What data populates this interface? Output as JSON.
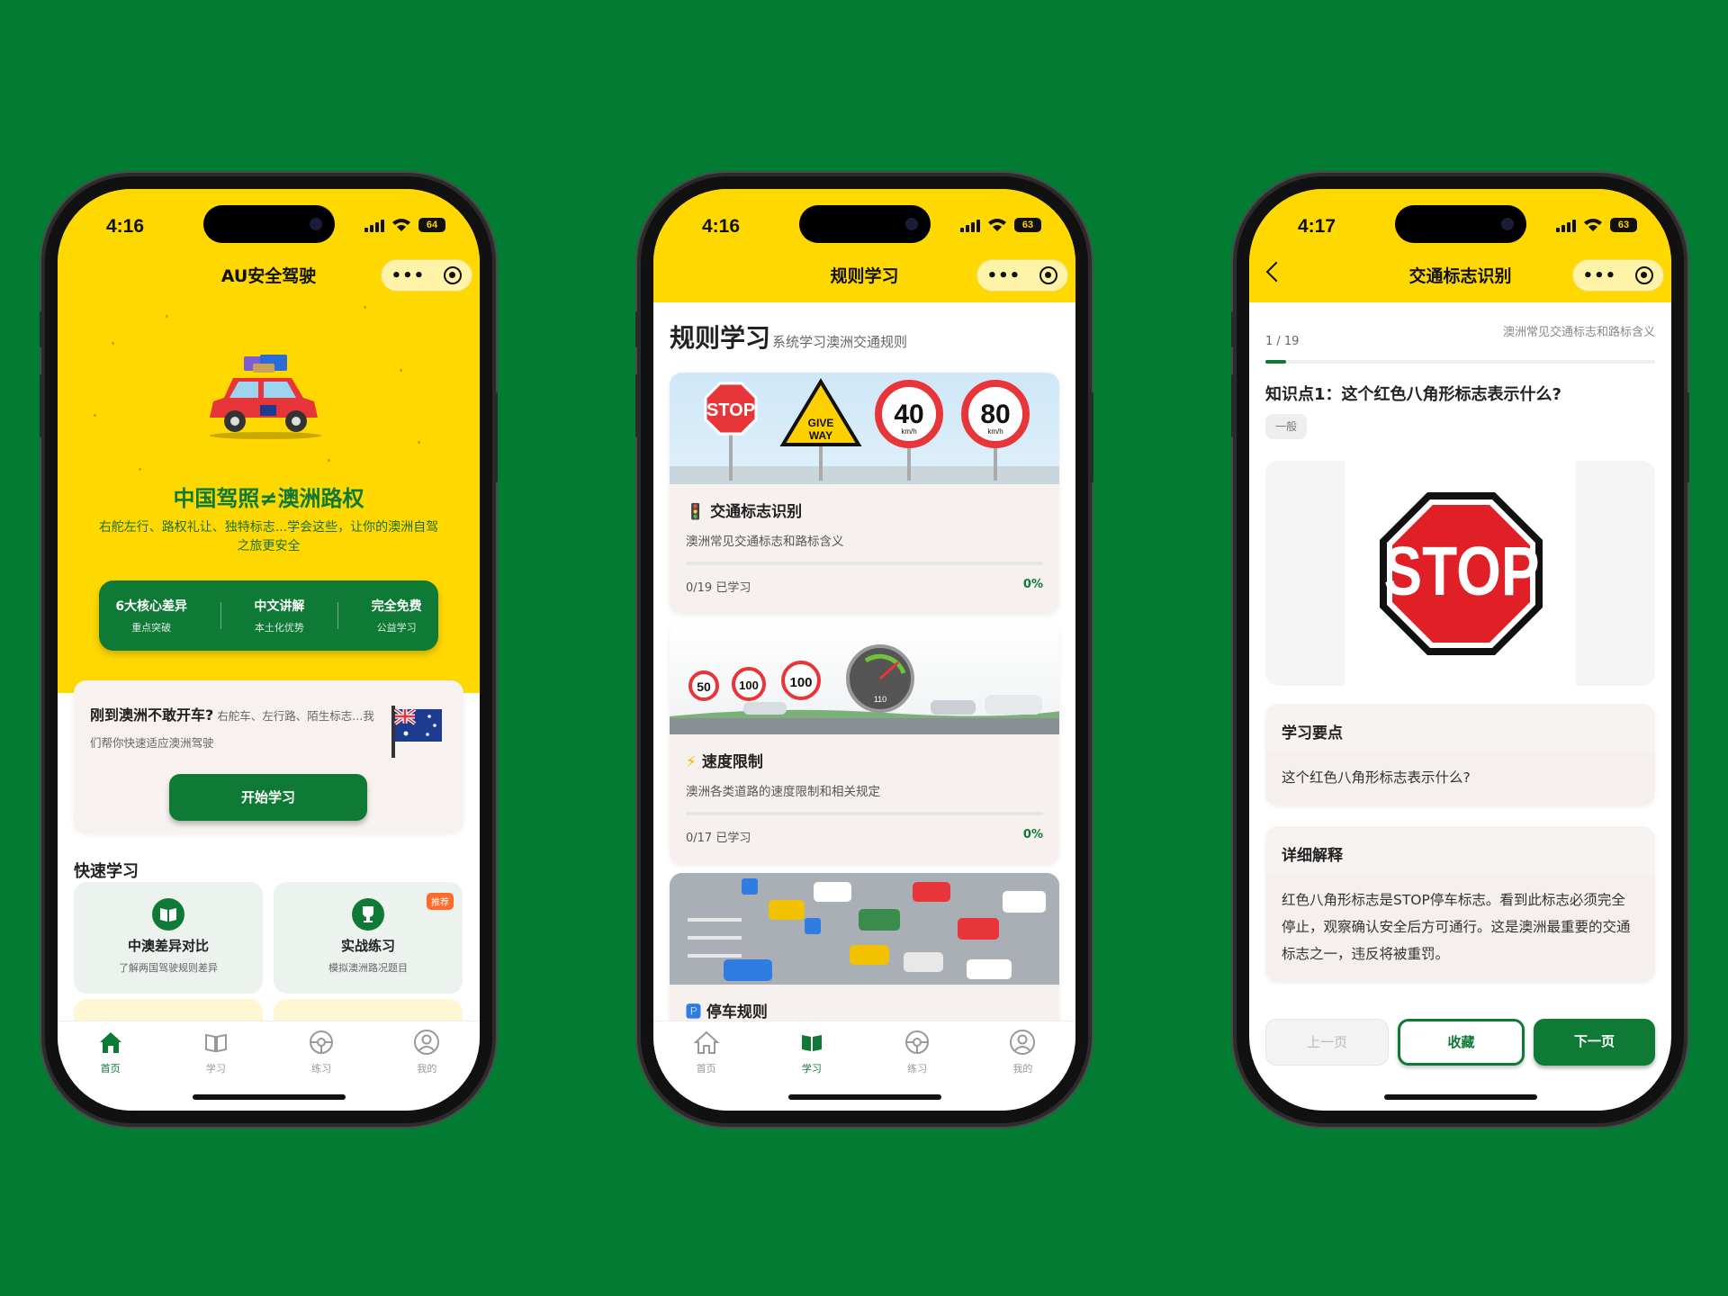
{
  "colors": {
    "background": "#017c32",
    "brand_yellow": "#ffd800",
    "brand_green": "#0e7a35"
  },
  "tabbar": {
    "home": "首页",
    "study": "学习",
    "practice": "练习",
    "mine": "我的"
  },
  "phone1": {
    "time": "4:16",
    "battery": "64",
    "nav_title": "AU安全驾驶",
    "hero_title": "中国驾照≠澳洲路权",
    "hero_sub": "右舵左行、路权礼让、独特标志...学会这些，让你的澳洲自驾之旅更安全",
    "features": [
      {
        "title": "6大核心差异",
        "sub": "重点突破"
      },
      {
        "title": "中文讲解",
        "sub": "本土化优势"
      },
      {
        "title": "完全免费",
        "sub": "公益学习"
      }
    ],
    "promo_question": "刚到澳洲不敢开车?",
    "promo_detail": "右舵车、左行路、陌生标志...我们帮你快速适应澳洲驾驶",
    "start_button": "开始学习",
    "quick_title": "快速学习",
    "quick": [
      {
        "title": "中澳差异对比",
        "sub": "了解两国驾驶规则差异",
        "icon": "book-icon"
      },
      {
        "title": "实战练习",
        "sub": "模拟澳洲路况题目",
        "badge": "推荐",
        "icon": "trophy-icon"
      }
    ]
  },
  "phone2": {
    "time": "4:16",
    "battery": "63",
    "nav_title": "规则学习",
    "heading": "规则学习",
    "subheading": "系统学习澳洲交通规则",
    "cards": [
      {
        "icon": "🚦",
        "title": "交通标志识别",
        "desc": "澳洲常见交通标志和路标含义",
        "progress": "0/19 已学习",
        "percent": "0%",
        "progress_value": 0
      },
      {
        "icon": "⚡",
        "title": "速度限制",
        "desc": "澳洲各类道路的速度限制和相关规定",
        "progress": "0/17 已学习",
        "percent": "0%",
        "progress_value": 0
      },
      {
        "icon": "🅿",
        "title": "停车规则"
      }
    ],
    "sign_texts": {
      "stop": "STOP",
      "give": "GIVE",
      "way": "WAY",
      "s40": "40",
      "s80": "80",
      "kmh": "km/h",
      "l50": "50",
      "l100a": "100",
      "l100b": "100",
      "gauge": "110"
    }
  },
  "phone3": {
    "time": "4:17",
    "battery": "63",
    "nav_title": "交通标志识别",
    "counter": "1 / 19",
    "progress_fraction": 0.053,
    "topic": "澳洲常见交通标志和路标含义",
    "question": "知识点1：这个红色八角形标志表示什么?",
    "tag": "一般",
    "sign_text": "STOP",
    "key_points_title": "学习要点",
    "key_points": "这个红色八角形标志表示什么?",
    "explain_title": "详细解释",
    "explain": "红色八角形标志是STOP停车标志。看到此标志必须完全停止，观察确认安全后方可通行。这是澳洲最重要的交通标志之一，违反将被重罚。",
    "prev": "上一页",
    "fav": "收藏",
    "next": "下一页"
  }
}
